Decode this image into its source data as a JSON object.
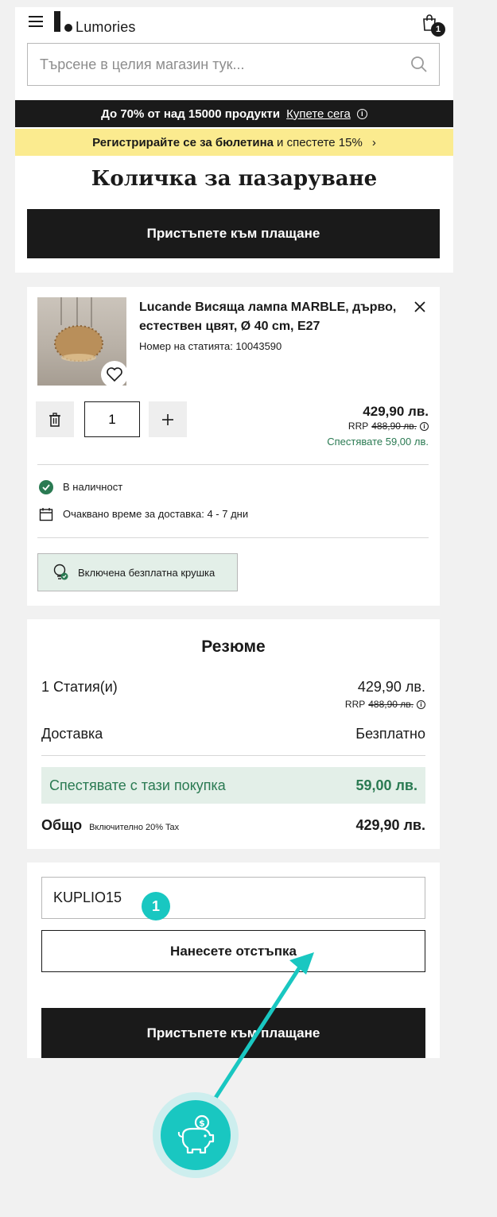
{
  "header": {
    "logo_text": "Lumories",
    "cart_count": "1",
    "search_placeholder": "Търсене в целия магазин тук..."
  },
  "promo": {
    "bar1_text": "До 70% от над 15000 продукти",
    "bar1_link": "Купете сега",
    "bar2_bold": "Регистрирайте се за бюлетина",
    "bar2_rest": "и спестете 15%"
  },
  "page_title": "Количка за пазаруване",
  "checkout_label": "Пристъпете към плащане",
  "product": {
    "name": "Lucande Висяща лампа MARBLE, дърво, естествен цвят, Ø 40 cm, E27",
    "article": "Номер на статията: 10043590",
    "quantity": "1",
    "price": "429,90 лв.",
    "rrp_label": "RRP",
    "rrp_value": "488,90 лв.",
    "savings": "Спестявате 59,00 лв.",
    "stock": "В наличност",
    "delivery": "Очаквано време за доставка: 4 - 7 дни",
    "bonus": "Включена безплатна крушка"
  },
  "summary": {
    "title": "Резюме",
    "items_label": "1 Статия(и)",
    "items_value": "429,90 лв.",
    "rrp_label": "RRP",
    "rrp_value": "488,90 лв.",
    "delivery_label": "Доставка",
    "delivery_value": "Безплатно",
    "savings_label": "Спестявате с тази покупка",
    "savings_value": "59,00 лв.",
    "total_label": "Общо",
    "total_note": "Включително 20% Tax",
    "total_value": "429,90 лв."
  },
  "coupon": {
    "code": "KUPLIO15",
    "apply_label": "Нанесете отстъпка"
  },
  "annotation": {
    "step": "1"
  },
  "colors": {
    "dark": "#1a1a1a",
    "promo_yellow": "#fbeb8f",
    "savings_green": "#2a7a52",
    "savings_bg": "#e3efe8",
    "annotation_teal": "#19c7c1"
  }
}
